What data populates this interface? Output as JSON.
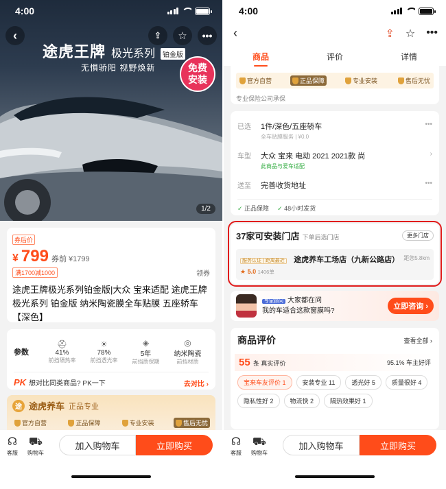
{
  "status": {
    "time": "4:00"
  },
  "left": {
    "hero": {
      "brand": "途虎王牌",
      "series": "极光系列",
      "edition": "铂金版",
      "slogan": "无惧骄阳 视野焕新",
      "badge_line1": "免费",
      "badge_line2": "安装",
      "image_counter": "1/2"
    },
    "price": {
      "coupon_label": "券后价",
      "currency": "¥",
      "value": "799",
      "original": "券前 ¥1799",
      "discount": "满1700减1000",
      "collect": "领券",
      "title": "途虎王牌极光系列铂金版|大众 宝来适配 途虎王牌 极光系列 铂金版 纳米陶瓷膜全车贴膜 五座轿车【深色】"
    },
    "params": {
      "label": "参数",
      "items": [
        {
          "icon": "⛑",
          "value": "41%",
          "label": "前挡隔热率"
        },
        {
          "icon": "☀",
          "value": "78%",
          "label": "前挡透光率"
        },
        {
          "icon": "◈",
          "value": "5年",
          "label": "前挡质保期"
        },
        {
          "icon": "◎",
          "value": "纳米陶瓷",
          "label": "前挡材质"
        }
      ],
      "pk_logo": "PK",
      "pk_text": "想对比同类商品? PK一下",
      "pk_action": "去对比 ›"
    },
    "brand_guarantee": {
      "logo_text": "途",
      "name": "途虎养车",
      "sub": "正品专业",
      "items": [
        "官方自营",
        "正品保障",
        "专业安装",
        "售后无忧"
      ]
    },
    "bottom": {
      "service": "客服",
      "cart": "购物车",
      "add_cart": "加入购物车",
      "buy_now": "立即购买"
    }
  },
  "right": {
    "tabs": [
      "商品",
      "评价",
      "详情"
    ],
    "guarantee": {
      "items": [
        "官方自营",
        "正品保障",
        "专业安装",
        "售后无忧"
      ],
      "insurance": "专业保险公司承保"
    },
    "selection": {
      "selected_key": "已选",
      "selected_value": "1件/深色/五座轿车",
      "selected_sub": "全车贴膜服务 | ¥0.0",
      "car_key": "车型",
      "car_value": "大众 宝来 电动 2021 2021款 尚",
      "car_sub": "此商品与爱车适配",
      "ship_key": "送至",
      "ship_value": "完善收货地址",
      "ship_tags": [
        "正品保障",
        "48小时发货"
      ]
    },
    "stores": {
      "title": "37家可安装门店",
      "hint": "下单后选门店",
      "more": "更多门店",
      "tag": "服务认证 | 距离最近",
      "name": "途虎养车工场店（九新公路店）",
      "distance": "距您5.8km",
      "rating": "★ 5.0",
      "reviews": "1406单"
    },
    "consult": {
      "expert": "专家顾问",
      "line1": "大家都在问",
      "line2": "我的车适合这款窗膜吗?",
      "button": "立即咨询 ›"
    },
    "reviews": {
      "title": "商品评价",
      "view_all": "查看全部 ›",
      "count": "55",
      "count_label": "条 真实评价",
      "rate": "95.1% 车主好评",
      "chips": [
        "宝来车友评价 1",
        "安装专业 11",
        "透光好 5",
        "质量很好 4",
        "隐私性好 2",
        "物流快 2",
        "隔热效果好 1"
      ]
    },
    "bottom": {
      "service": "客服",
      "cart": "购物车",
      "add_cart": "加入购物车",
      "buy_now": "立即购买"
    }
  }
}
